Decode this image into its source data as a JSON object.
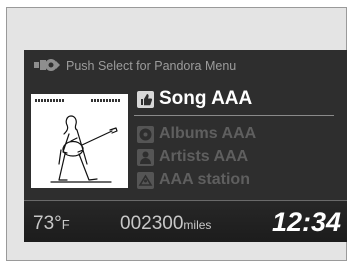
{
  "header": {
    "hint_text": "Push Select for Pandora Menu",
    "hint_icon": "interface-dial-icon"
  },
  "now_playing": {
    "album_art": "guitar-player-illustration",
    "song": "Song AAA",
    "albums": "Albums AAA",
    "artists": "Artists AAA",
    "station": "AAA station",
    "icons": {
      "song": "thumbs-up-icon",
      "albums": "disc-icon",
      "artists": "person-icon",
      "station": "station-icon"
    }
  },
  "status_bar": {
    "temperature_value": "73°",
    "temperature_unit": "F",
    "odometer_value": "002300",
    "odometer_unit": "miles",
    "clock": "12:34"
  },
  "colors": {
    "screen_background": "#2e2e2e",
    "frame_background": "#e4e4e4",
    "active_text": "#ffffff",
    "inactive_text": "#5f5f5f"
  }
}
